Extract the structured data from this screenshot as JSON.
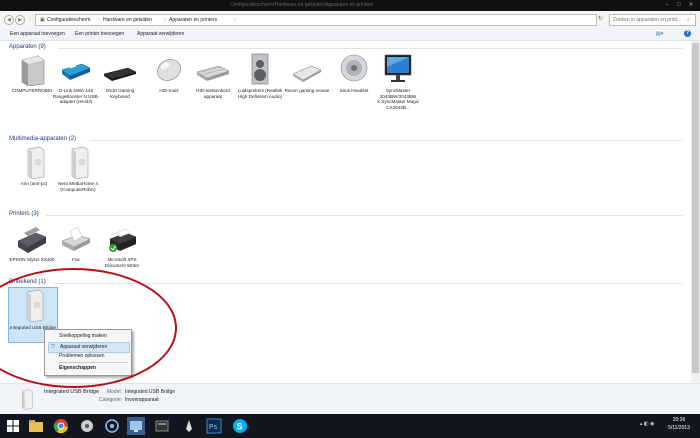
{
  "window": {
    "title": "Configuratiescherm\\Hardware en geluiden\\Apparaten en printers"
  },
  "address": {
    "crumbs": [
      "Configuratiescherm",
      "Hardware en geluiden",
      "Apparaten en printers"
    ],
    "search_placeholder": "Zoeken in apparaten en print..."
  },
  "toolbar": {
    "add_device": "Een apparaat toevoegen",
    "add_printer": "Een printer toevoegen",
    "remove_device": "Apparaat verwijderen"
  },
  "sections": {
    "devices": "Apparaten (9)",
    "multimedia": "Multimedia-apparaten (2)",
    "printers": "Printers (3)",
    "unspecified": "Onbekend (1)"
  },
  "devices": [
    {
      "label": "COMPUTERROBIN",
      "icon": "computer-icon"
    },
    {
      "label": "D-Link DWA-140 RangeBooster N USB-adapter (rev.B2)",
      "icon": "usb-adapter-icon"
    },
    {
      "label": "G510 Gaming Keyboard",
      "icon": "keyboard-icon"
    },
    {
      "label": "HID-muis",
      "icon": "mouse-icon"
    },
    {
      "label": "HID-toetsenbord apparaat",
      "icon": "keyboard-icon"
    },
    {
      "label": "Luidsprekers (Realtek High Definition Audio)",
      "icon": "speaker-icon"
    },
    {
      "label": "Recon gaming mouse",
      "icon": "mouse-icon"
    },
    {
      "label": "Sirus Headset",
      "icon": "speaker-icon"
    },
    {
      "label": "SyncMaster 2043BW/2043BW X,SyncMaster Magic CX2043B...",
      "icon": "monitor-icon"
    }
  ],
  "multimedia": [
    {
      "label": "Ann (ann-pc)",
      "icon": "media-server-icon"
    },
    {
      "label": "Nero MediaHome 4 (ComputerRobin)",
      "icon": "media-server-icon"
    }
  ],
  "printers": [
    {
      "label": "EPSON Stylus SX400",
      "icon": "printer-icon"
    },
    {
      "label": "Fax",
      "icon": "fax-icon"
    },
    {
      "label": "Microsoft XPS Document Writer",
      "icon": "printer-icon"
    }
  ],
  "unspecified": [
    {
      "label": "Integrated USB Bridge",
      "icon": "usb-bridge-icon"
    }
  ],
  "context_menu": [
    "Snelkoppeling maken",
    "Apparaat verwijderen",
    "Problemen oplossen",
    "Eigenschappen"
  ],
  "details": {
    "name": "Integrated USB Bridge",
    "model_label": "Model:",
    "model_value": "Integrated USB Bridge",
    "category_label": "Categorie:",
    "category_value": "Invoerapparaat"
  },
  "clock": {
    "time": "20:36",
    "date": "5/11/2013"
  },
  "taskbar_apps": [
    "explorer-icon",
    "chrome-icon",
    "media-icon",
    "skype-icon",
    "photoshop-icon"
  ],
  "colors": {
    "accent": "#1e3c78",
    "selection": "#cde6f7",
    "highlight_ring": "#b8101a"
  }
}
